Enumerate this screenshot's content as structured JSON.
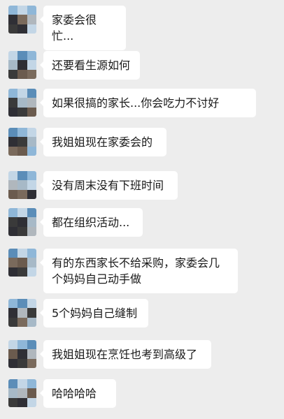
{
  "messages": [
    {
      "text": "家委会很忙..."
    },
    {
      "text": "还要看生源如何"
    },
    {
      "text": "如果很搞的家长...你会吃力不讨好"
    },
    {
      "text": "我姐姐现在家委会的"
    },
    {
      "text": "没有周末没有下班时间"
    },
    {
      "text": "都在组织活动..."
    },
    {
      "text": "有的东西家长不给采购，家委会几个妈妈自己动手做"
    },
    {
      "text": "5个妈妈自己缝制"
    },
    {
      "text": "我姐姐现在烹饪也考到高级了"
    },
    {
      "text": "哈哈哈哈"
    }
  ],
  "colors": {
    "background": "#ededed",
    "bubble": "#ffffff",
    "text": "#191919",
    "avatar_palette": [
      "#5b8db8",
      "#8fb7d8",
      "#c3d6e6",
      "#3a3a3a",
      "#6b5b4e",
      "#a7b9c7",
      "#2f2f35",
      "#7a6a5c",
      "#b0b7bd"
    ]
  },
  "avatar_icon": "pixelated-avatar-icon"
}
